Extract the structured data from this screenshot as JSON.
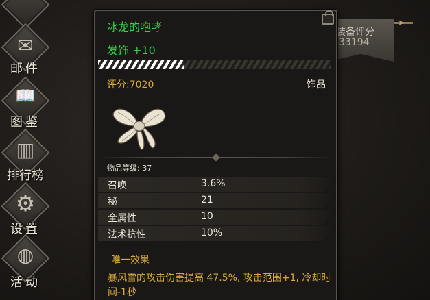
{
  "side_menu": [
    {
      "label": "邮件",
      "icon": "mail-icon",
      "glyph": "✉"
    },
    {
      "label": "图鉴",
      "icon": "book-icon",
      "glyph": "📖"
    },
    {
      "label": "排行榜",
      "icon": "ranking-icon",
      "glyph": "▥"
    },
    {
      "label": "设置",
      "icon": "gear-icon",
      "glyph": "⚙"
    },
    {
      "label": "活动",
      "icon": "event-icon",
      "glyph": "◍"
    }
  ],
  "equip_score": {
    "title": "装备评分",
    "value": "33194"
  },
  "tooltip": {
    "name": "冰龙的咆哮",
    "slot_line": "发饰 +10",
    "enhance_progress": 0.37,
    "score_line": "评分:7020",
    "category": "饰品",
    "item_icon": "bow-hair-accessory",
    "level_line": "物品等级: 37",
    "stats": [
      {
        "name": "召唤",
        "value": "3.6%"
      },
      {
        "name": "秘",
        "value": "21"
      },
      {
        "name": "全属性",
        "value": "10"
      },
      {
        "name": "法术抗性",
        "value": "10%"
      }
    ],
    "unique_title": "唯一效果",
    "unique_desc": "暴风雪的攻击伤害提高 47.5%, 攻击范围+1, 冷却时间-1秒"
  },
  "colors": {
    "item_name": "#33d24a",
    "gold_text": "#d7a83a"
  }
}
